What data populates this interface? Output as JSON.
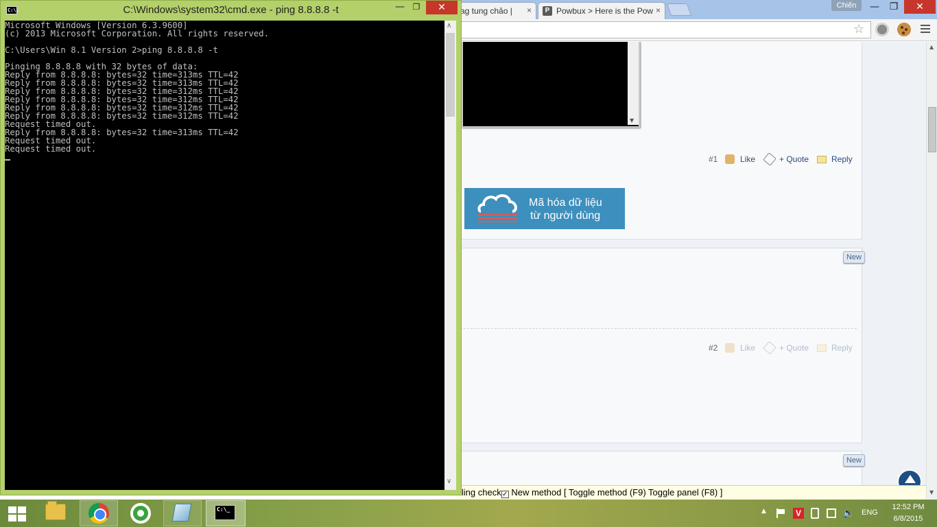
{
  "browser": {
    "tabs": [
      {
        "title": "ag tung chảo |"
      },
      {
        "title": "Powbux > Here is the Pow",
        "favicon": "P"
      }
    ],
    "tab_close_glyph": "×",
    "profile_name": "Chiến",
    "window_controls": {
      "minimize": "—",
      "maximize": "❐",
      "close": "✕"
    },
    "toolbar_icons": [
      "star-icon",
      "extension-icon",
      "cookie-extension-icon",
      "menu-icon"
    ]
  },
  "forum": {
    "post1": {
      "number": "#1",
      "like": "Like",
      "quote": "+ Quote",
      "reply": "Reply"
    },
    "banner": {
      "line1": "Mã hóa dữ liệu",
      "line2": "từ người dùng",
      "color": "#3d8fbd"
    },
    "post2": {
      "badge": "New",
      "number": "#2",
      "like": "Like",
      "quote": "+ Quote",
      "reply": "Reply"
    },
    "post3": {
      "badge": "New"
    }
  },
  "statusbar": {
    "prefix": "lling check",
    "checkbox_checked": true,
    "method": "New method",
    "links": "[ Toggle method (F9) Toggle panel (F8) ]"
  },
  "cmd": {
    "title": "C:\\Windows\\system32\\cmd.exe - ping  8.8.8.8 -t",
    "icon_text": "C:\\.",
    "window_controls": {
      "minimize": "—",
      "maximize": "❐",
      "close": "✕"
    },
    "lines": [
      "Microsoft Windows [Version 6.3.9600]",
      "(c) 2013 Microsoft Corporation. All rights reserved.",
      "",
      "C:\\Users\\Win 8.1 Version 2>ping 8.8.8.8 -t",
      "",
      "Pinging 8.8.8.8 with 32 bytes of data:",
      "Reply from 8.8.8.8: bytes=32 time=313ms TTL=42",
      "Reply from 8.8.8.8: bytes=32 time=313ms TTL=42",
      "Reply from 8.8.8.8: bytes=32 time=312ms TTL=42",
      "Reply from 8.8.8.8: bytes=32 time=312ms TTL=42",
      "Reply from 8.8.8.8: bytes=32 time=312ms TTL=42",
      "Reply from 8.8.8.8: bytes=32 time=312ms TTL=42",
      "Request timed out.",
      "Reply from 8.8.8.8: bytes=32 time=313ms TTL=42",
      "Request timed out.",
      "Request timed out."
    ],
    "colors": {
      "background": "#000000",
      "text": "#c0c0c0",
      "frame": "#b4d06a"
    }
  },
  "taskbar": {
    "apps": [
      "file-explorer-icon",
      "chrome-icon",
      "coccoc-icon",
      "app-icon",
      "cmd-icon"
    ],
    "cmd_icon_text": "C:\\_",
    "tray": {
      "language": "ENG",
      "time": "12:52 PM",
      "date": "6/8/2015",
      "v_icon_text": "V"
    }
  }
}
